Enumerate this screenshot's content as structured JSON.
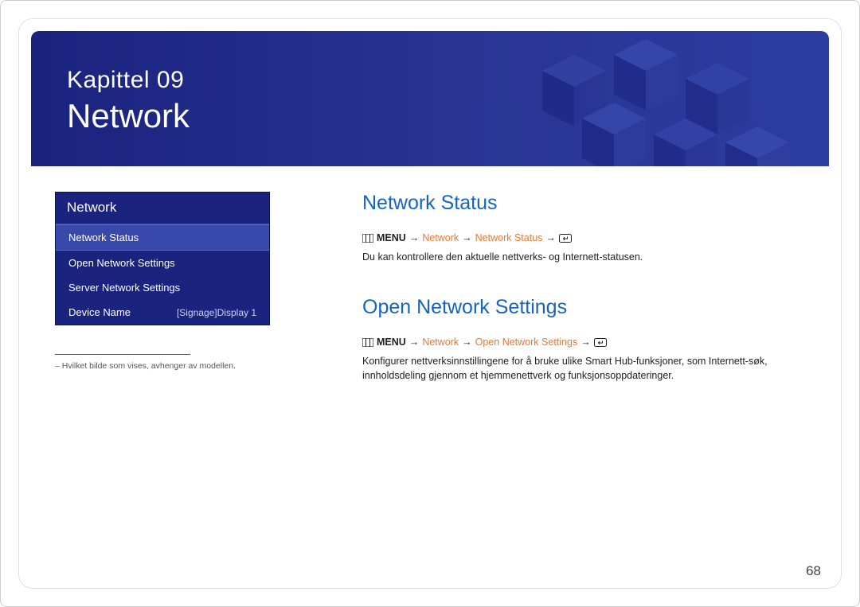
{
  "banner": {
    "chapter_label": "Kapittel 09",
    "title": "Network"
  },
  "sidebar": {
    "panel_title": "Network",
    "items": [
      {
        "label": "Network Status",
        "selected": true
      },
      {
        "label": "Open Network Settings",
        "selected": false
      },
      {
        "label": "Server Network Settings",
        "selected": false
      },
      {
        "label": "Device Name",
        "value": "[Signage]Display 1",
        "selected": false
      }
    ],
    "footnote": "– Hvilket bilde som vises, avhenger av modellen."
  },
  "content": {
    "sections": [
      {
        "heading": "Network Status",
        "breadcrumb": {
          "menu_label": "MENU",
          "path": [
            "Network",
            "Network Status"
          ]
        },
        "body": "Du kan kontrollere den aktuelle nettverks- og Internett-statusen."
      },
      {
        "heading": "Open Network Settings",
        "breadcrumb": {
          "menu_label": "MENU",
          "path": [
            "Network",
            "Open Network Settings"
          ]
        },
        "body": "Konfigurer nettverksinnstillingene for å bruke ulike Smart Hub-funksjoner, som Internett-søk, innholdsdeling gjennom et hjemmenettverk og funksjonsoppdateringer."
      }
    ]
  },
  "page_number": "68"
}
